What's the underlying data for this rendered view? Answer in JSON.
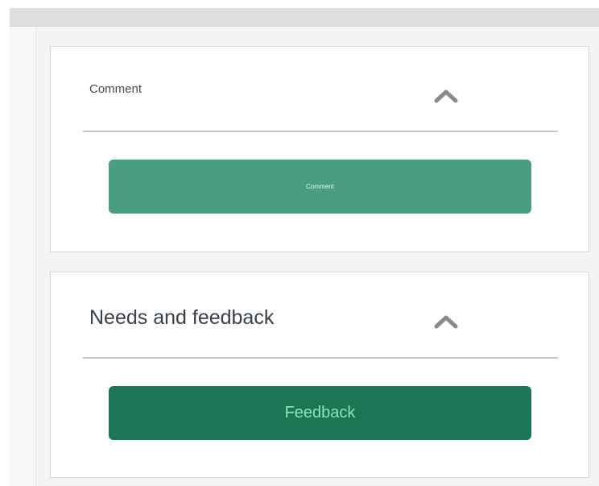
{
  "panels": {
    "comment": {
      "title": "Comment",
      "button_label": "Comment"
    },
    "feedback": {
      "title": "Needs and feedback",
      "button_label": "Feedback"
    }
  },
  "icons": {
    "collapse": "chevron-up-icon"
  },
  "colors": {
    "comment_button": "#4a9e80",
    "feedback_button": "#1c7656",
    "feedback_button_text": "#8fe1b8"
  }
}
